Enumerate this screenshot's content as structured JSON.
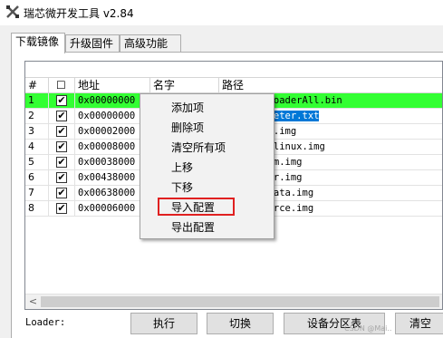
{
  "window": {
    "title": "瑞芯微开发工具 v2.84"
  },
  "tabs": [
    {
      "label": "下载镜像"
    },
    {
      "label": "升级固件"
    },
    {
      "label": "高级功能"
    }
  ],
  "table": {
    "headers": {
      "num": "#",
      "check": "☐",
      "addr": "地址",
      "name": "名字",
      "path": "路径"
    },
    "rows": [
      {
        "num": "1",
        "addr": "0x00000000",
        "path": "ges\\MiniLoaderAll.bin",
        "checked": true
      },
      {
        "num": "2",
        "addr": "0x00000000",
        "path": "ges\\parameter.txt",
        "checked": true
      },
      {
        "num": "3",
        "addr": "0x00002000",
        "path": "ges\\uboot.img",
        "checked": true
      },
      {
        "num": "4",
        "addr": "0x00008000",
        "path": "ges\\boot_linux.img",
        "checked": true
      },
      {
        "num": "5",
        "addr": "0x00038000",
        "path": "ges\\system.img",
        "checked": true
      },
      {
        "num": "6",
        "addr": "0x00438000",
        "path": "ges\\vendor.img",
        "checked": true
      },
      {
        "num": "7",
        "addr": "0x00638000",
        "path": "ges\\userdata.img",
        "checked": true
      },
      {
        "num": "8",
        "addr": "0x00006000",
        "path": "ges\\resource.img",
        "checked": true
      }
    ],
    "check_glyph": "✔",
    "scroll_left_arrow": "<"
  },
  "context_menu": {
    "items": [
      "添加项",
      "删除项",
      "清空所有项",
      "上移",
      "下移",
      "导入配置",
      "导出配置"
    ],
    "highlighted_index": 5
  },
  "footer": {
    "loader_label": "Loader:",
    "buttons": [
      "执行",
      "切换",
      "设备分区表",
      "清空"
    ]
  },
  "watermark": "CSDN @Mai..",
  "colors": {
    "selected_row": "#33ff33",
    "path_selection": "#0078d7",
    "highlight_border": "#e02020"
  }
}
